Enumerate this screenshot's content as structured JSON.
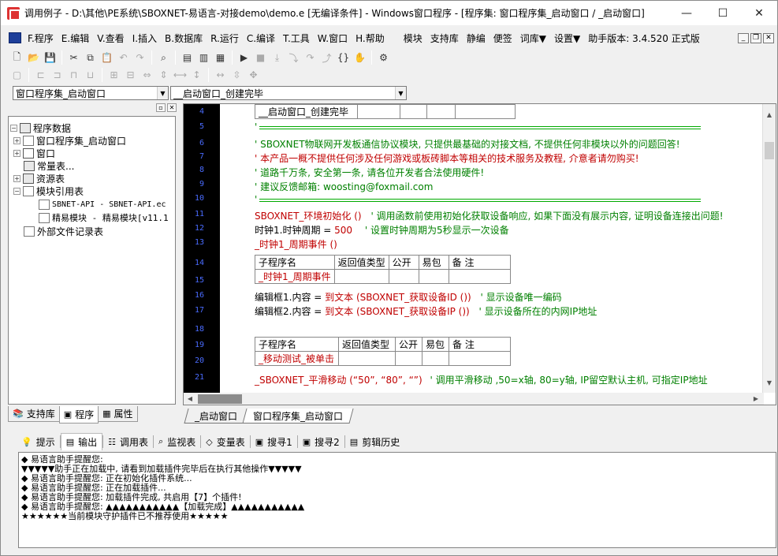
{
  "window": {
    "title": "调用例子 - D:\\其他\\PE系统\\SBOXNET-易语言-对接demo\\demo.e [无编译条件] - Windows窗口程序 - [程序集: 窗口程序集_启动窗口 / _启动窗口]",
    "minimize": "—",
    "maximize": "☐",
    "close": "✕"
  },
  "menubar": {
    "items": [
      "F.程序",
      "E.编辑",
      "V.查看",
      "I.插入",
      "B.数据库",
      "R.运行",
      "C.编译",
      "T.工具",
      "W.窗口",
      "H.帮助"
    ],
    "extras": [
      "模块",
      "支持库",
      "静编",
      "便签",
      "词库▼",
      "设置▼"
    ],
    "version": "助手版本: 3.4.520 正式版"
  },
  "toolbar3": {
    "assembly_select": "窗口程序集_启动窗口",
    "sub_select": "__启动窗口_创建完毕"
  },
  "tree": {
    "root": "程序数据",
    "items": [
      {
        "label": "窗口程序集_启动窗口"
      },
      {
        "label": "窗口"
      },
      {
        "label": "常量表..."
      },
      {
        "label": "资源表"
      },
      {
        "label": "模块引用表"
      },
      {
        "label": "SBNET-API - SBNET-API.ec"
      },
      {
        "label": "精易模块 - 精易模块[v11.1"
      },
      {
        "label": "外部文件记录表"
      }
    ]
  },
  "left_tabs": [
    "支持库",
    "程序",
    "属性"
  ],
  "editor": {
    "line_numbers": [
      "4",
      "5",
      "6",
      "7",
      "8",
      "9",
      "10",
      "11",
      "12",
      "13",
      "14",
      "15",
      "16",
      "17",
      "18",
      "19",
      "20",
      "21"
    ],
    "header_row": "__启动窗口_创建完毕",
    "c1": "'",
    "c2": "' SBOXNET物联网开发板通信协议模块, 只提供最基础的对接文档, 不提供任何非模块以外的问题回答!",
    "c3": "' 本产品一概不提供任何涉及任何游戏或板砖脚本等相关的技术服务及教程, 介意者请勿购买!",
    "c4": "' 道路千万条, 安全第一条, 请各位开发者合法使用硬件!",
    "c5": "' 建议反馈邮箱: woosting@foxmail.com",
    "c6": "'",
    "l11a": "SBOXNET_环境初始化 ()",
    "l11b": "' 调用函数前使用初始化获取设备响应, 如果下面没有展示内容, 证明设备连接出问题!",
    "l12a": "时钟1.时钟周期 = ",
    "l12b": "500",
    "l12c": "' 设置时钟周期为5秒显示一次设备",
    "l13": "_时钟1_周期事件 ()",
    "table_headers": [
      "子程序名",
      "返回值类型",
      "公开",
      "易包",
      "备 注"
    ],
    "t1_name": "_时钟1_周期事件",
    "l16a": "编辑框1.内容 = ",
    "l16b": "到文本 (SBOXNET_获取设备ID ())",
    "l16c": "' 显示设备唯一编码",
    "l17a": "编辑框2.内容 = ",
    "l17b": "到文本 (SBOXNET_获取设备IP ())",
    "l17c": "' 显示设备所在的内网IP地址",
    "t2_name": "_移动测试_被单击",
    "l21a": "_SBOXNET_平滑移动 (“50”, “80”, “”)",
    "l21b": "' 调用平滑移动 ,50=x轴, 80=y轴, IP留空默认主机, 可指定IP地址"
  },
  "editor_tabs": [
    "_启动窗口",
    "窗口程序集_启动窗口"
  ],
  "bottom_tabs": [
    "提示",
    "输出",
    "调用表",
    "监视表",
    "变量表",
    "搜寻1",
    "搜寻2",
    "剪辑历史"
  ],
  "output_lines": [
    "◆ 易语言助手提醒您:",
    "▼▼▼▼▼助手正在加载中, 请看到加载插件完毕后在执行其他操作▼▼▼▼▼",
    "◆ 易语言助手提醒您: 正在初始化插件系统...",
    "◆ 易语言助手提醒您: 正在加载插件...",
    "◆ 易语言助手提醒您: 加载插件完成, 共启用【7】个插件!",
    "◆ 易语言助手提醒您: ▲▲▲▲▲▲▲▲▲▲▲【加载完成】▲▲▲▲▲▲▲▲▲▲▲",
    "★★★★★★当前模块守护插件已不推荐使用★★★★★"
  ]
}
